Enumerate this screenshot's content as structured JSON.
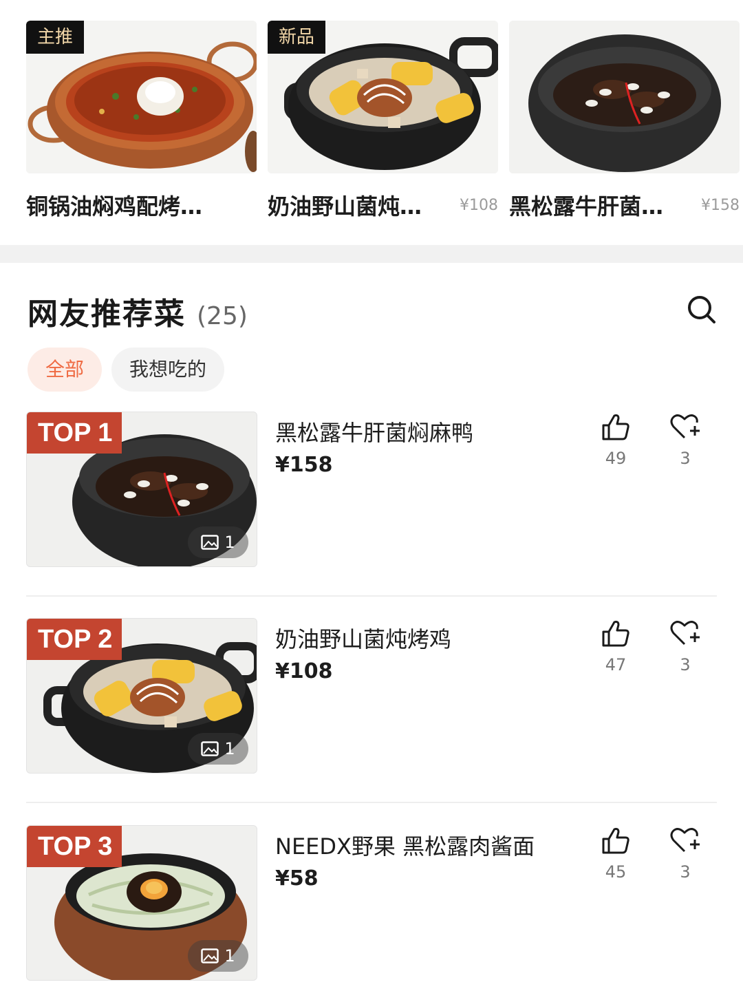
{
  "carousel": [
    {
      "tag": "主推",
      "name": "铜锅油焖鸡配烤…",
      "price": ""
    },
    {
      "tag": "新品",
      "name": "奶油野山菌炖…",
      "price": "¥108"
    },
    {
      "tag": "",
      "name": "黑松露牛肝菌…",
      "price": "¥158"
    }
  ],
  "section": {
    "title": "网友推荐菜",
    "count": "(25)",
    "search_icon": "search-icon"
  },
  "filters": [
    {
      "label": "全部",
      "active": true
    },
    {
      "label": "我想吃的",
      "active": false
    }
  ],
  "dishes": [
    {
      "rank": "TOP 1",
      "name": "黑松露牛肝菌焖麻鸭",
      "price": "¥158",
      "likes": "49",
      "favs": "3",
      "photos": "1"
    },
    {
      "rank": "TOP 2",
      "name": "奶油野山菌炖烤鸡",
      "price": "¥108",
      "likes": "47",
      "favs": "3",
      "photos": "1"
    },
    {
      "rank": "TOP 3",
      "name": "NEEDX野果 黑松露肉酱面",
      "price": "¥58",
      "likes": "45",
      "favs": "3",
      "photos": "1"
    }
  ],
  "colors": {
    "accent": "#ef6a42",
    "badge": "#c44530",
    "tag_bg": "#111111",
    "tag_text": "#f2d7a8"
  }
}
